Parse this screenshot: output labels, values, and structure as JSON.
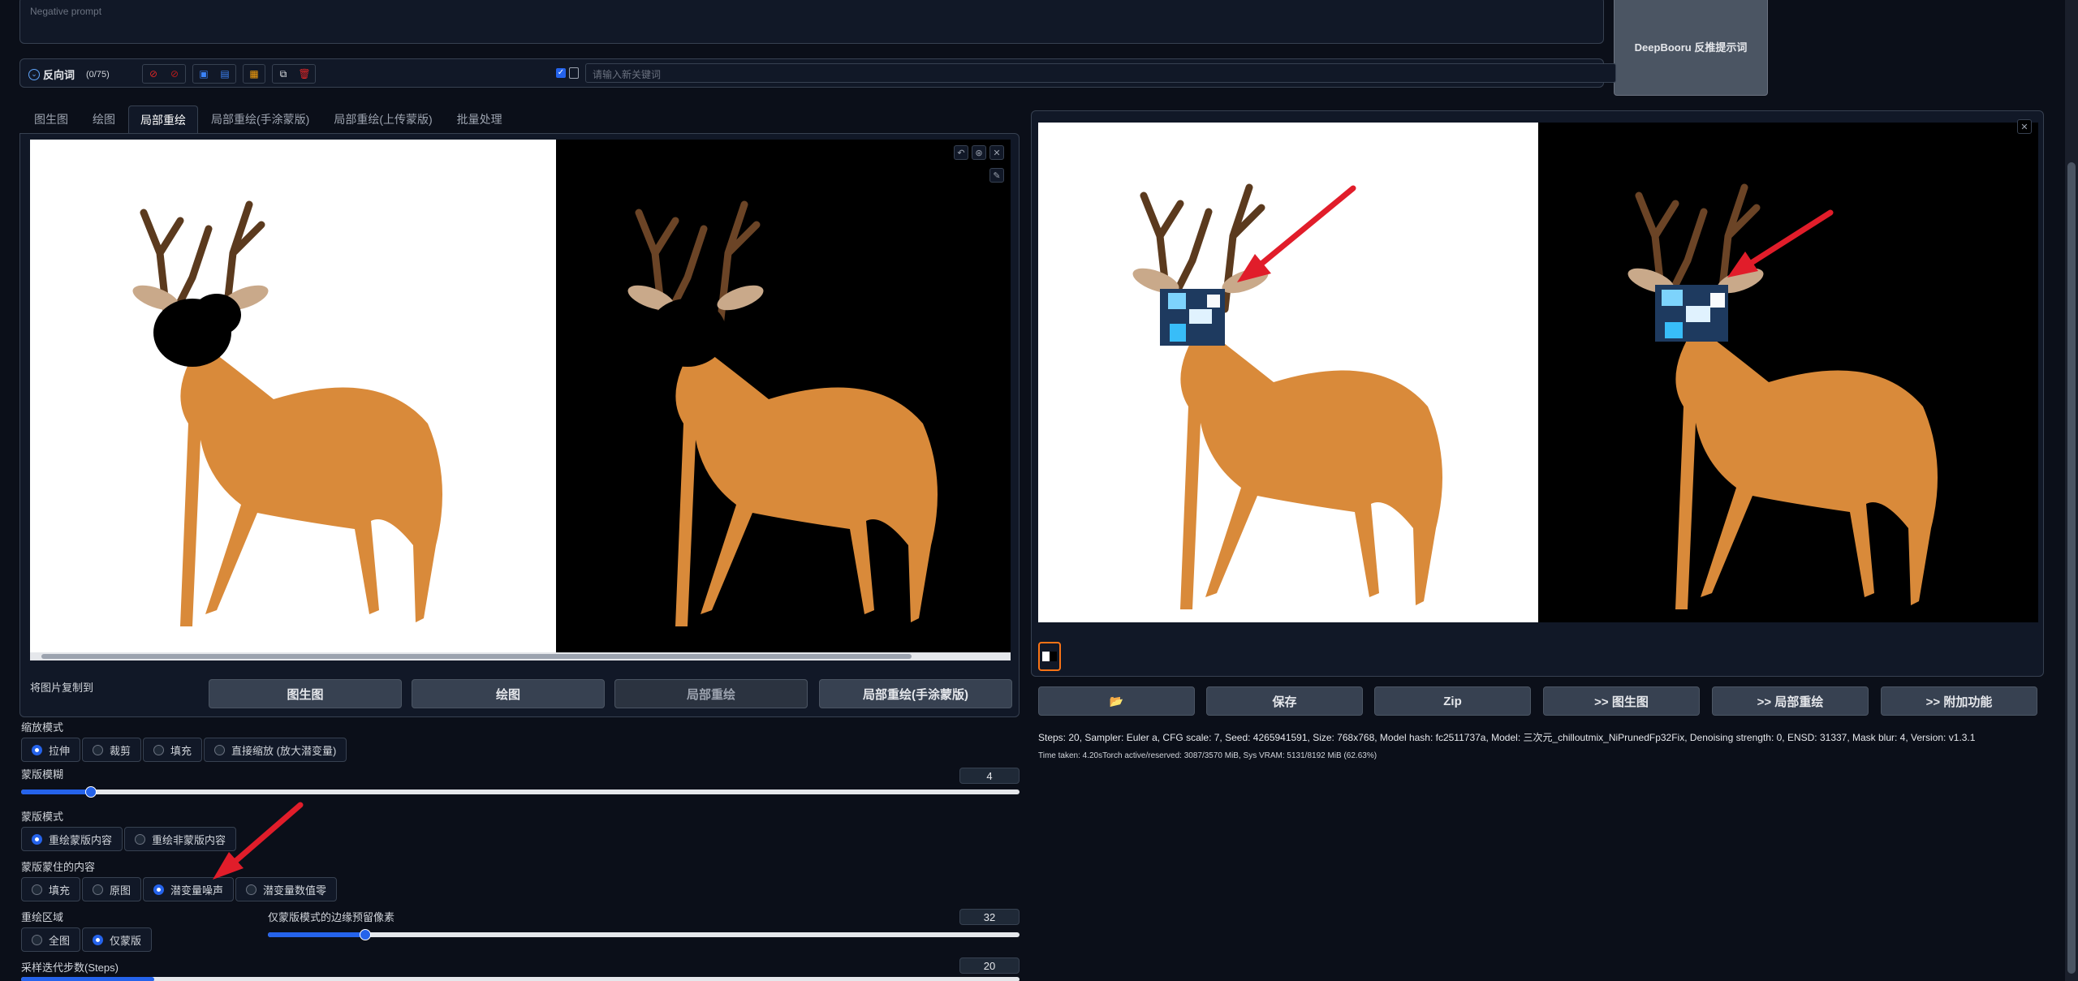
{
  "prompt": {
    "negative_placeholder": "Negative prompt",
    "deepbooru_label": "DeepBooru 反推提示词"
  },
  "neg_bar": {
    "label": "反向词",
    "count": "(0/75)",
    "keyword_placeholder": "请输入新关键词"
  },
  "tabs": [
    "图生图",
    "绘图",
    "局部重绘",
    "局部重绘(手涂蒙版)",
    "局部重绘(上传蒙版)",
    "批量处理"
  ],
  "copy_row": {
    "label": "将图片复制到",
    "buttons": [
      "图生图",
      "绘图",
      "局部重绘",
      "局部重绘(手涂蒙版)"
    ]
  },
  "resize_mode": {
    "label": "缩放模式",
    "options": [
      "拉伸",
      "裁剪",
      "填充",
      "直接缩放 (放大潜变量)"
    ],
    "selected": "拉伸"
  },
  "mask_blur": {
    "label": "蒙版模糊",
    "value": "4",
    "fraction": 0.07
  },
  "mask_mode": {
    "label": "蒙版模式",
    "options": [
      "重绘蒙版内容",
      "重绘非蒙版内容"
    ],
    "selected": "重绘蒙版内容"
  },
  "masked_content": {
    "label": "蒙版蒙住的内容",
    "options": [
      "填充",
      "原图",
      "潜变量噪声",
      "潜变量数值零"
    ],
    "selected": "潜变量噪声"
  },
  "inpaint_area": {
    "label": "重绘区域",
    "options": [
      "全图",
      "仅蒙版"
    ],
    "selected": "仅蒙版"
  },
  "padding": {
    "label": "仅蒙版模式的边缘预留像素",
    "value": "32",
    "fraction": 0.13
  },
  "steps": {
    "label": "采样迭代步数(Steps)",
    "value": "20"
  },
  "output": {
    "buttons": [
      "📂",
      "保存",
      "Zip",
      ">> 图生图",
      ">> 局部重绘",
      ">> 附加功能"
    ],
    "info_line": "Steps: 20, Sampler: Euler a, CFG scale: 7, Seed: 4265941591, Size: 768x768, Model hash: fc2511737a, Model: 三次元_chilloutmix_NiPrunedFp32Fix, Denoising strength: 0, ENSD: 31337, Mask blur: 4, Version: v1.3.1",
    "time_line": "Time taken: 4.20sTorch active/reserved: 3087/3570 MiB, Sys VRAM: 5131/8192 MiB (62.63%)"
  },
  "colors": {
    "accent": "#2563eb",
    "arrow": "#e11d2a",
    "background": "#0b0f19"
  }
}
